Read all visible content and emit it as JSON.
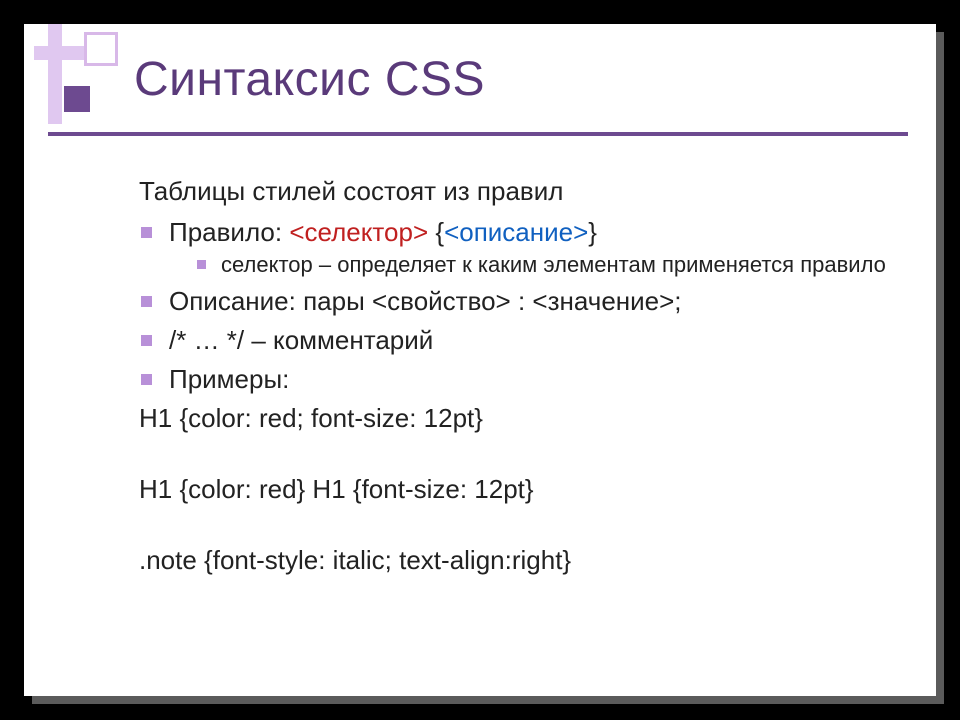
{
  "title": "Синтаксис CSS",
  "intro": "Таблицы стилей состоят из правил",
  "bullets": {
    "rule_label": "Правило: ",
    "rule_sel": "<селектор>",
    "rule_brace_open": " {",
    "rule_desc": "<описание>",
    "rule_brace_close": "}",
    "sub_selector": "селектор – определяет к каким элементам применяется правило",
    "description": "Описание: пары <свойство> : <значение>;",
    "comment": "/* … */ – комментарий",
    "examples_label": "Примеры:"
  },
  "examples": {
    "ex1": "H1 {color: red; font-size: 12pt}",
    "ex2": "H1 {color: red} H1 {font-size: 12pt}",
    "ex3": ".note {font-style: italic; text-align:right}"
  }
}
